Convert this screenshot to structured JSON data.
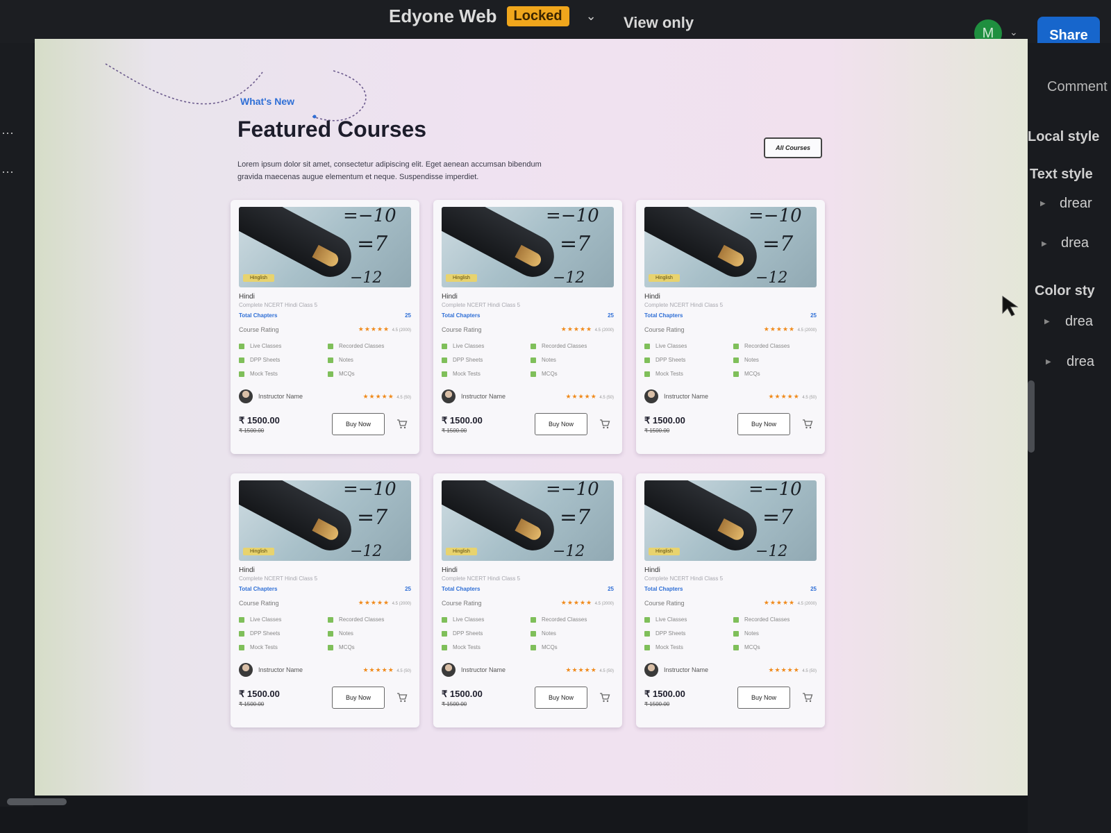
{
  "topbar": {
    "title": "Edyone Web",
    "locked_label": "Locked",
    "view_mode": "View only",
    "avatar_initial": "M",
    "share_label": "Share"
  },
  "right_panel": {
    "comment": "Comment",
    "local_styles": "Local style",
    "text_styles": "Text style",
    "text_items": [
      "drear",
      "drea"
    ],
    "color_styles": "Color sty",
    "color_items": [
      "drea",
      "drea"
    ]
  },
  "design": {
    "eyebrow": "What's New",
    "title": "Featured Courses",
    "description": "Lorem ipsum dolor sit amet, consectetur adipiscing elit. Eget aenean accumsan bibendum gravida maecenas augue elementum et neque. Suspendisse imperdiet.",
    "all_courses_label": "All Courses",
    "card": {
      "language_tag": "Hinglish",
      "subject": "Hindi",
      "subtitle": "Complete NCERT Hindi Class 5",
      "chapters_label": "Total Chapters",
      "chapters_count": "25",
      "rating_label": "Course Rating",
      "rating_stars": "★★★★★",
      "rating_value": "4.5 (2000)",
      "features": [
        "Live Classes",
        "Recorded Classes",
        "DPP Sheets",
        "Notes",
        "Mock Tests",
        "MCQs"
      ],
      "instructor": "Instructor Name",
      "instructor_stars": "★★★★★",
      "instructor_rating": "4.5 (50)",
      "price": "₹ 1500.00",
      "old_price": "₹ 1500.00",
      "buy_label": "Buy Now"
    },
    "card_count": 6
  },
  "colors": {
    "share": "#1766cc",
    "locked": "#f0a61c",
    "accent_blue": "#2f6fd6",
    "star": "#f08a1b"
  },
  "icons": [
    "chevron-down-icon",
    "cart-icon",
    "checkbox-icon",
    "cursor-arrow-icon",
    "more-dots-icon"
  ]
}
